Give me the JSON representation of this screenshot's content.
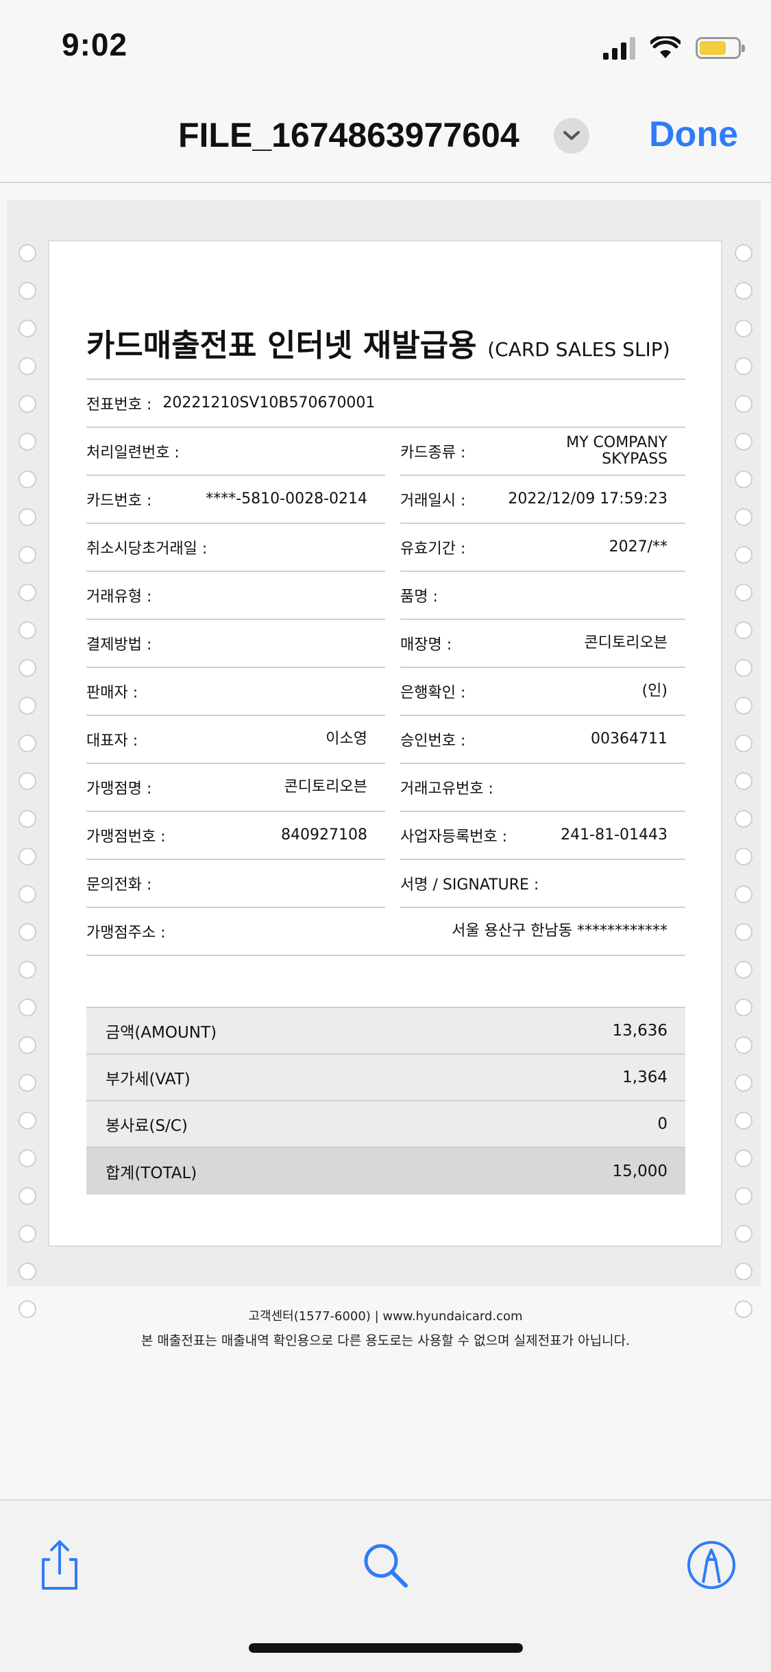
{
  "status_bar": {
    "time": "9:02"
  },
  "nav": {
    "title": "FILE_1674863977604",
    "done_label": "Done"
  },
  "slip": {
    "title": "카드매출전표 인터넷 재발급용",
    "subtitle": "(CARD SALES SLIP)",
    "slip_no": {
      "label": "전표번호 :",
      "value": "20221210SV10B570670001"
    },
    "left_fields": [
      {
        "label": "처리일련번호 :",
        "value": ""
      },
      {
        "label": "카드번호 :",
        "value": "****-5810-0028-0214"
      },
      {
        "label": "취소시당초거래일 :",
        "value": ""
      },
      {
        "label": "거래유형 :",
        "value": ""
      },
      {
        "label": "결제방법 :",
        "value": ""
      },
      {
        "label": "판매자 :",
        "value": ""
      },
      {
        "label": "대표자 :",
        "value": "이소영"
      },
      {
        "label": "가맹점명 :",
        "value": "콘디토리오븐"
      },
      {
        "label": "가맹점번호 :",
        "value": "840927108"
      },
      {
        "label": "문의전화 :",
        "value": ""
      }
    ],
    "right_fields": [
      {
        "label": "카드종류 :",
        "value_line1": "MY COMPANY",
        "value_line2": "SKYPASS"
      },
      {
        "label": "거래일시 :",
        "value": "2022/12/09 17:59:23"
      },
      {
        "label": "유효기간 :",
        "value": "2027/**"
      },
      {
        "label": "품명 :",
        "value": ""
      },
      {
        "label": "매장명 :",
        "value": "콘디토리오븐"
      },
      {
        "label": "은행확인 :",
        "value": "(인)"
      },
      {
        "label": "승인번호 :",
        "value": "00364711"
      },
      {
        "label": "거래고유번호 :",
        "value": ""
      },
      {
        "label": "사업자등록번호 :",
        "value": "241-81-01443"
      },
      {
        "label": "서명 / SIGNATURE :",
        "value": ""
      }
    ],
    "address": {
      "label": "가맹점주소 :",
      "value": "서울 용산구 한남동 ************"
    },
    "summary": [
      {
        "label": "금액(AMOUNT)",
        "value": "13,636"
      },
      {
        "label": "부가세(VAT)",
        "value": "1,364"
      },
      {
        "label": "봉사료(S/C)",
        "value": "0"
      },
      {
        "label": "합계(TOTAL)",
        "value": "15,000"
      }
    ]
  },
  "footer": {
    "line1": "고객센터(1577-6000)  |  www.hyundaicard.com",
    "line2": "본 매출전표는 매출내역 확인용으로 다른 용도로는 사용할 수 없으며 실제전표가 아닙니다."
  },
  "toolbar": {
    "icons": [
      "share-icon",
      "search-icon",
      "markup-icon"
    ]
  },
  "colors": {
    "accent": "#2f7cf6",
    "battery": "#f4cd3e"
  }
}
